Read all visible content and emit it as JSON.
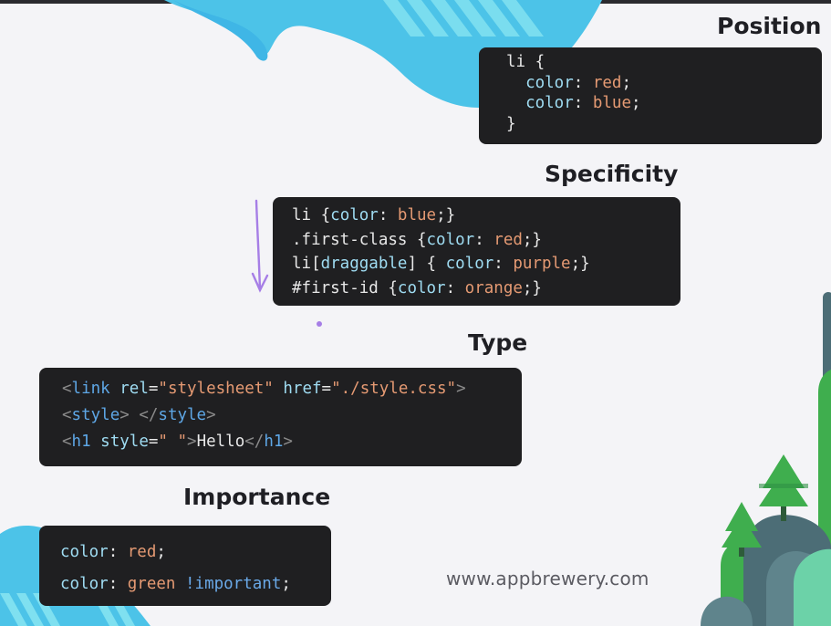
{
  "sections": {
    "position": {
      "heading": "Position",
      "lines": [
        [
          "li {"
        ],
        [
          "  color",
          ": ",
          "red",
          ";"
        ],
        [
          "  color",
          ": ",
          "blue",
          ";"
        ],
        [
          "}"
        ]
      ]
    },
    "specificity": {
      "heading": "Specificity",
      "lines": [
        [
          "li {",
          "color",
          ": ",
          "blue",
          ";}"
        ],
        [
          ".first-class {",
          "color",
          ": ",
          "red",
          ";}"
        ],
        [
          "li[",
          "draggable",
          "] { ",
          "color",
          ": ",
          "purple",
          ";}"
        ],
        [
          "#first-id {",
          "color",
          ": ",
          "orange",
          ";}"
        ]
      ]
    },
    "type": {
      "heading": "Type",
      "line1": {
        "open": "<",
        "tag": "link",
        "attr1": "rel",
        "eq1": "=",
        "val1": "\"stylesheet\"",
        "attr2": "href",
        "eq2": "=",
        "val2": "\"./style.css\"",
        "close": ">"
      },
      "line2": {
        "open": "<",
        "tag": "style",
        "close": ">",
        "space": " ",
        "endopen": "</",
        "endtag": "style",
        "endclose": ">"
      },
      "line3": {
        "open": "<",
        "tag": "h1",
        "attr": "style",
        "eq": "=",
        "val": "\" \"",
        "close": ">",
        "text": "Hello",
        "endopen": "</",
        "endtag": "h1",
        "endclose": ">"
      }
    },
    "importance": {
      "heading": "Importance",
      "line1": {
        "prop": "color",
        "sep": ": ",
        "val": "red",
        "end": ";"
      },
      "line2": {
        "prop": "color",
        "sep": ": ",
        "val": "green",
        "space": " ",
        "imp": "!important",
        "end": ";"
      }
    }
  },
  "watermark": "www.appbrewery.com",
  "colors": {
    "background": "#f4f4f7",
    "code_bg": "#1f1f21",
    "property": "#9fdcf2",
    "value": "#e59a73",
    "tag": "#5ea7e6",
    "annotation_arrow": "#a67ee6"
  }
}
